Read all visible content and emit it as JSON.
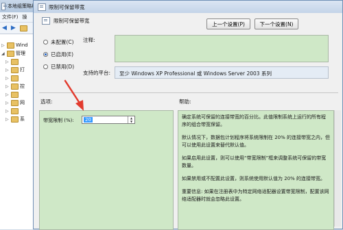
{
  "background_window": {
    "title": "本地组策略编辑",
    "menu": [
      "文件(F)",
      "操"
    ],
    "tree": [
      {
        "label": "Wind",
        "expanded": false
      },
      {
        "label": "管理",
        "expanded": true
      },
      {
        "label": "",
        "expanded": false
      },
      {
        "label": "打",
        "expanded": false
      },
      {
        "label": "",
        "expanded": false
      },
      {
        "label": "控",
        "expanded": false
      },
      {
        "label": "",
        "expanded": false
      },
      {
        "label": "网",
        "expanded": false
      },
      {
        "label": "",
        "expanded": false
      },
      {
        "label": "系",
        "expanded": false
      }
    ]
  },
  "dialog": {
    "title": "限制可保留带宽",
    "header_title": "限制可保留带宽",
    "prev_button": "上一个设置(P)",
    "next_button": "下一个设置(N)",
    "options": [
      {
        "label": "未配置(C)",
        "selected": false
      },
      {
        "label": "已启用(E)",
        "selected": true
      },
      {
        "label": "已禁用(D)",
        "selected": false
      }
    ],
    "comment_label": "注释:",
    "comment_value": "",
    "platform_label": "支持的平台:",
    "platform_value": "至少 Windows XP Professional 或 Windows Server 2003 系列",
    "options_label": "选项:",
    "help_label": "帮助:",
    "bandwidth_label": "带宽限制 (%):",
    "bandwidth_value": "20",
    "help_paragraphs": [
      "确定系统可保留的连接带宽的百分比。此值限制系统上运行的所有程序的组合带宽保留。",
      "默认情况下，数据包计划程序将系统限制在 20% 的连接带宽之内，但可以使用此设置来替代默认值。",
      "如果启用此设置，则可以使用“带宽限制”框来调整系统可保留的带宽数量。",
      "如果禁用或不配置此设置，则系统使用默认值为 20% 的连接带宽。",
      "重要信息: 如果在注册表中为特定网络适配器设置带宽限制，配置该网络适配器时就会忽略此设置。"
    ]
  },
  "colors": {
    "annotation_arrow": "#e23b2e",
    "panel_green": "#cfe8c7",
    "selection": "#3399ff"
  }
}
